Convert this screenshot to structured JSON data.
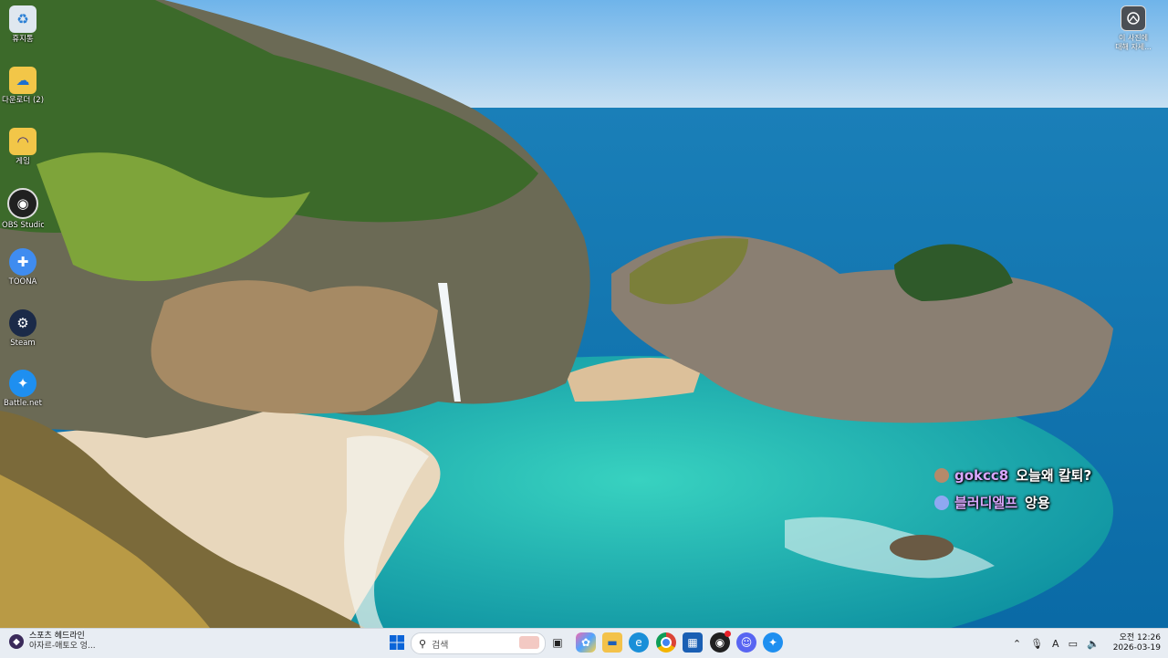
{
  "desktop": {
    "icons": [
      {
        "label": "휴지통",
        "icon": "recycle-bin-icon"
      },
      {
        "label": "다운로더 (2)",
        "icon": "folder-icon"
      },
      {
        "label": "게임",
        "icon": "folder-icon"
      },
      {
        "label": "OBS Studio",
        "icon": "obs-icon"
      },
      {
        "label": "TOONA",
        "icon": "toona-icon"
      },
      {
        "label": "Steam",
        "icon": "steam-icon"
      },
      {
        "label": "Battle.net",
        "icon": "battlenet-icon"
      }
    ],
    "info_widget": {
      "line1": "이 사진에",
      "line2": "대해 자세..."
    }
  },
  "chat_overlay": [
    {
      "user": "gokcc8",
      "message": "오늘왜 칼퇴?"
    },
    {
      "user": "블러디엘프",
      "message": "앙용"
    }
  ],
  "taskbar": {
    "weather": {
      "title": "스포츠 헤드라인",
      "subtitle": "아자르-애토오 엉..."
    },
    "search_placeholder": "검색",
    "pinned": [
      {
        "icon": "task-view-icon"
      },
      {
        "icon": "copilot-icon"
      },
      {
        "icon": "file-explorer-icon"
      },
      {
        "icon": "edge-icon"
      },
      {
        "icon": "chrome-icon"
      },
      {
        "icon": "store-icon"
      },
      {
        "icon": "obs-icon"
      },
      {
        "icon": "discord-icon"
      },
      {
        "icon": "battlenet-icon"
      }
    ],
    "tray": {
      "ime": "A",
      "time": "오전 12:26",
      "date": "2026-03-19"
    }
  },
  "colors": {
    "taskbar_bg": "#e8edf3",
    "chat_user": "#d9a8ff",
    "accent": "#0a64d8"
  }
}
